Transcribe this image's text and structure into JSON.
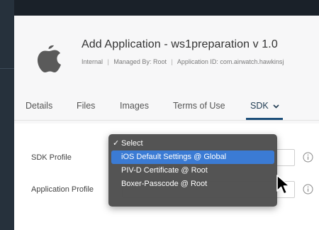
{
  "app": {
    "title": "Add Application - ws1preparation v 1.0",
    "meta_type": "Internal",
    "meta_managed_by": "Managed By: Root",
    "meta_app_id": "Application ID: com.airwatch.hawkinsj"
  },
  "tabs": [
    {
      "label": "Details"
    },
    {
      "label": "Files"
    },
    {
      "label": "Images"
    },
    {
      "label": "Terms of Use"
    },
    {
      "label": "SDK",
      "active": true
    }
  ],
  "form": {
    "sdk_profile_label": "SDK Profile",
    "application_profile_label": "Application Profile"
  },
  "dropdown": {
    "options": [
      {
        "label": "Select",
        "checked": true
      },
      {
        "label": "iOS Default Settings @ Global",
        "highlighted": true
      },
      {
        "label": "PIV-D Certificate @ Root"
      },
      {
        "label": "Boxer-Passcode @ Root"
      }
    ]
  },
  "colors": {
    "accent_underline": "#1d4f7a",
    "highlight": "#3b7bd4",
    "menu_bg": "#4e4e4e"
  },
  "icons": [
    "apple-logo-icon",
    "chevron-down-icon",
    "info-icon",
    "pointer-cursor-icon"
  ]
}
